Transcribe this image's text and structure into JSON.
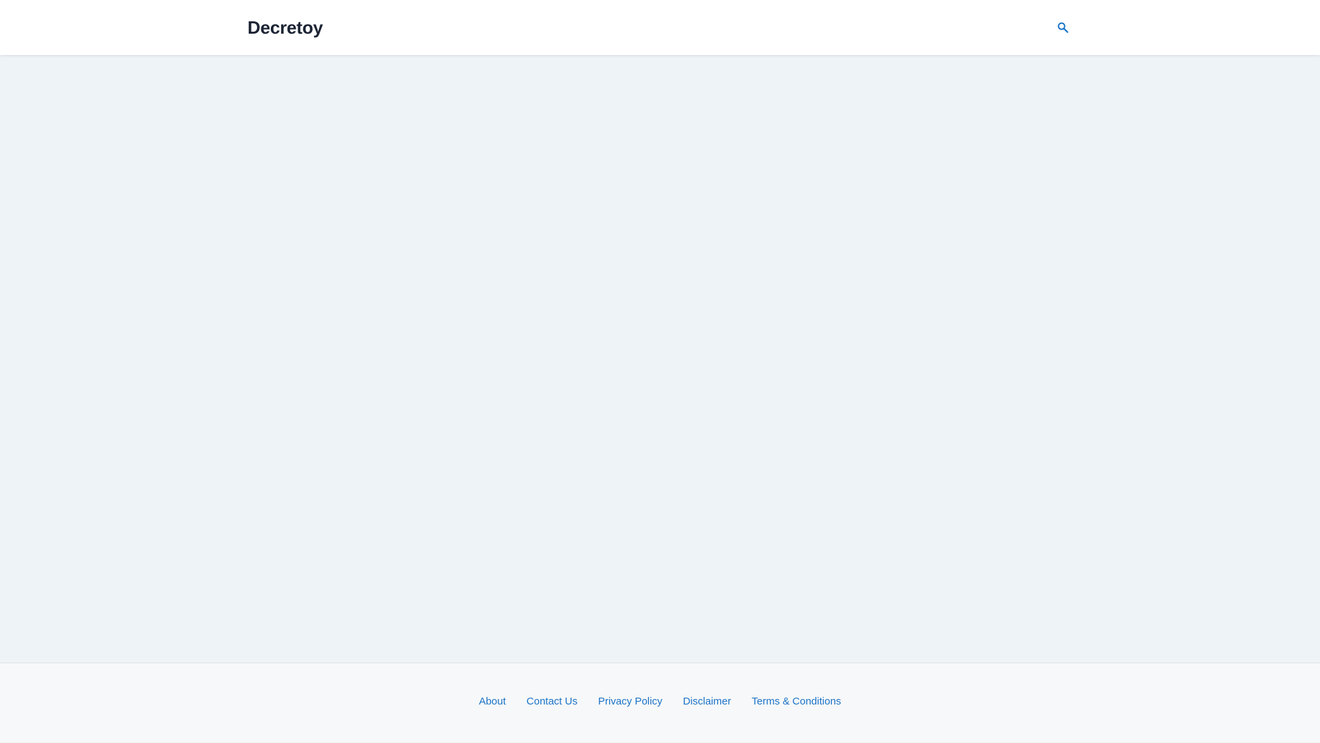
{
  "header": {
    "site_title": "Decretoy",
    "search_icon": "search-icon"
  },
  "footer": {
    "links": [
      {
        "label": "About"
      },
      {
        "label": "Contact Us"
      },
      {
        "label": "Privacy Policy"
      },
      {
        "label": "Disclaimer"
      },
      {
        "label": "Terms & Conditions"
      }
    ]
  },
  "colors": {
    "accent": "#1a73c8",
    "title": "#1c2434",
    "page_background": "#eef3f7",
    "footer_background": "#f7f8f9",
    "header_background": "#ffffff"
  }
}
